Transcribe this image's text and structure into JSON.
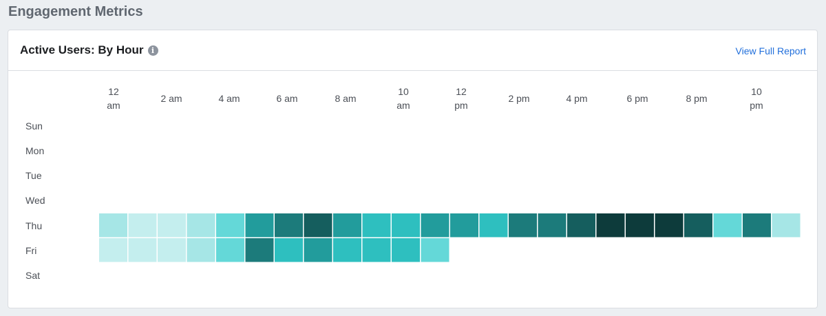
{
  "page": {
    "title": "Engagement Metrics"
  },
  "card": {
    "title": "Active Users: By Hour",
    "info_icon": "info-icon",
    "link_label": "View Full Report"
  },
  "colors": {
    "scale": [
      "#c4eeee",
      "#a6e6e6",
      "#64d8d8",
      "#2ebfbf",
      "#229c9c",
      "#1c7b7b",
      "#155e5e",
      "#0d3b3b"
    ],
    "link": "#216fdb"
  },
  "chart_data": {
    "type": "heatmap",
    "title": "",
    "x_labels": [
      [
        "12",
        "am"
      ],
      [
        "2 am"
      ],
      [
        "4 am"
      ],
      [
        "6 am"
      ],
      [
        "8 am"
      ],
      [
        "10",
        "am"
      ],
      [
        "12",
        "pm"
      ],
      [
        "2 pm"
      ],
      [
        "4 pm"
      ],
      [
        "6 pm"
      ],
      [
        "8 pm"
      ],
      [
        "10",
        "pm"
      ]
    ],
    "hours": [
      0,
      1,
      2,
      3,
      4,
      5,
      6,
      7,
      8,
      9,
      10,
      11,
      12,
      13,
      14,
      15,
      16,
      17,
      18,
      19,
      20,
      21,
      22,
      23
    ],
    "days": [
      "Sun",
      "Mon",
      "Tue",
      "Wed",
      "Thu",
      "Fri",
      "Sat"
    ],
    "intensity_levels": 8,
    "values": [
      [
        null,
        null,
        null,
        null,
        null,
        null,
        null,
        null,
        null,
        null,
        null,
        null,
        null,
        null,
        null,
        null,
        null,
        null,
        null,
        null,
        null,
        null,
        null,
        null
      ],
      [
        null,
        null,
        null,
        null,
        null,
        null,
        null,
        null,
        null,
        null,
        null,
        null,
        null,
        null,
        null,
        null,
        null,
        null,
        null,
        null,
        null,
        null,
        null,
        null
      ],
      [
        null,
        null,
        null,
        null,
        null,
        null,
        null,
        null,
        null,
        null,
        null,
        null,
        null,
        null,
        null,
        null,
        null,
        null,
        null,
        null,
        null,
        null,
        null,
        null
      ],
      [
        null,
        null,
        null,
        null,
        null,
        null,
        null,
        null,
        null,
        null,
        null,
        null,
        null,
        null,
        null,
        null,
        null,
        null,
        null,
        null,
        null,
        null,
        null,
        null
      ],
      [
        2,
        1,
        1,
        2,
        3,
        5,
        6,
        7,
        5,
        4,
        4,
        5,
        5,
        4,
        6,
        6,
        7,
        8,
        8,
        8,
        7,
        3,
        6,
        2
      ],
      [
        1,
        1,
        1,
        2,
        3,
        6,
        4,
        5,
        4,
        4,
        4,
        3,
        null,
        null,
        null,
        null,
        null,
        null,
        null,
        null,
        null,
        null,
        null,
        null
      ],
      [
        null,
        null,
        null,
        null,
        null,
        null,
        null,
        null,
        null,
        null,
        null,
        null,
        null,
        null,
        null,
        null,
        null,
        null,
        null,
        null,
        null,
        null,
        null,
        null
      ]
    ]
  }
}
